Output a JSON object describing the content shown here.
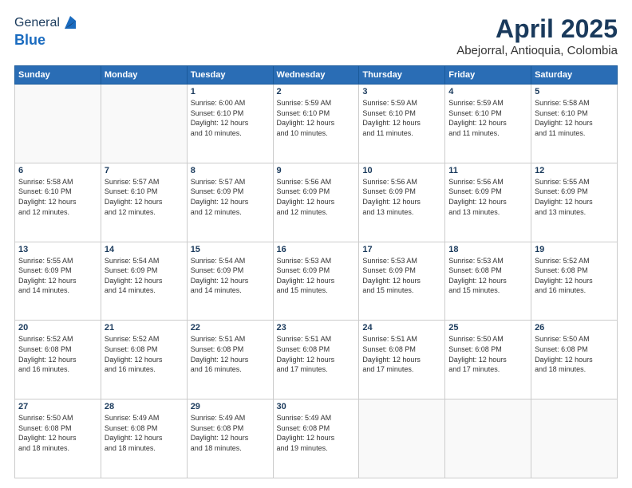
{
  "header": {
    "logo_general": "General",
    "logo_blue": "Blue",
    "title": "April 2025",
    "location": "Abejorral, Antioquia, Colombia"
  },
  "weekdays": [
    "Sunday",
    "Monday",
    "Tuesday",
    "Wednesday",
    "Thursday",
    "Friday",
    "Saturday"
  ],
  "weeks": [
    [
      {
        "day": "",
        "info": ""
      },
      {
        "day": "",
        "info": ""
      },
      {
        "day": "1",
        "info": "Sunrise: 6:00 AM\nSunset: 6:10 PM\nDaylight: 12 hours\nand 10 minutes."
      },
      {
        "day": "2",
        "info": "Sunrise: 5:59 AM\nSunset: 6:10 PM\nDaylight: 12 hours\nand 10 minutes."
      },
      {
        "day": "3",
        "info": "Sunrise: 5:59 AM\nSunset: 6:10 PM\nDaylight: 12 hours\nand 11 minutes."
      },
      {
        "day": "4",
        "info": "Sunrise: 5:59 AM\nSunset: 6:10 PM\nDaylight: 12 hours\nand 11 minutes."
      },
      {
        "day": "5",
        "info": "Sunrise: 5:58 AM\nSunset: 6:10 PM\nDaylight: 12 hours\nand 11 minutes."
      }
    ],
    [
      {
        "day": "6",
        "info": "Sunrise: 5:58 AM\nSunset: 6:10 PM\nDaylight: 12 hours\nand 12 minutes."
      },
      {
        "day": "7",
        "info": "Sunrise: 5:57 AM\nSunset: 6:10 PM\nDaylight: 12 hours\nand 12 minutes."
      },
      {
        "day": "8",
        "info": "Sunrise: 5:57 AM\nSunset: 6:09 PM\nDaylight: 12 hours\nand 12 minutes."
      },
      {
        "day": "9",
        "info": "Sunrise: 5:56 AM\nSunset: 6:09 PM\nDaylight: 12 hours\nand 12 minutes."
      },
      {
        "day": "10",
        "info": "Sunrise: 5:56 AM\nSunset: 6:09 PM\nDaylight: 12 hours\nand 13 minutes."
      },
      {
        "day": "11",
        "info": "Sunrise: 5:56 AM\nSunset: 6:09 PM\nDaylight: 12 hours\nand 13 minutes."
      },
      {
        "day": "12",
        "info": "Sunrise: 5:55 AM\nSunset: 6:09 PM\nDaylight: 12 hours\nand 13 minutes."
      }
    ],
    [
      {
        "day": "13",
        "info": "Sunrise: 5:55 AM\nSunset: 6:09 PM\nDaylight: 12 hours\nand 14 minutes."
      },
      {
        "day": "14",
        "info": "Sunrise: 5:54 AM\nSunset: 6:09 PM\nDaylight: 12 hours\nand 14 minutes."
      },
      {
        "day": "15",
        "info": "Sunrise: 5:54 AM\nSunset: 6:09 PM\nDaylight: 12 hours\nand 14 minutes."
      },
      {
        "day": "16",
        "info": "Sunrise: 5:53 AM\nSunset: 6:09 PM\nDaylight: 12 hours\nand 15 minutes."
      },
      {
        "day": "17",
        "info": "Sunrise: 5:53 AM\nSunset: 6:09 PM\nDaylight: 12 hours\nand 15 minutes."
      },
      {
        "day": "18",
        "info": "Sunrise: 5:53 AM\nSunset: 6:08 PM\nDaylight: 12 hours\nand 15 minutes."
      },
      {
        "day": "19",
        "info": "Sunrise: 5:52 AM\nSunset: 6:08 PM\nDaylight: 12 hours\nand 16 minutes."
      }
    ],
    [
      {
        "day": "20",
        "info": "Sunrise: 5:52 AM\nSunset: 6:08 PM\nDaylight: 12 hours\nand 16 minutes."
      },
      {
        "day": "21",
        "info": "Sunrise: 5:52 AM\nSunset: 6:08 PM\nDaylight: 12 hours\nand 16 minutes."
      },
      {
        "day": "22",
        "info": "Sunrise: 5:51 AM\nSunset: 6:08 PM\nDaylight: 12 hours\nand 16 minutes."
      },
      {
        "day": "23",
        "info": "Sunrise: 5:51 AM\nSunset: 6:08 PM\nDaylight: 12 hours\nand 17 minutes."
      },
      {
        "day": "24",
        "info": "Sunrise: 5:51 AM\nSunset: 6:08 PM\nDaylight: 12 hours\nand 17 minutes."
      },
      {
        "day": "25",
        "info": "Sunrise: 5:50 AM\nSunset: 6:08 PM\nDaylight: 12 hours\nand 17 minutes."
      },
      {
        "day": "26",
        "info": "Sunrise: 5:50 AM\nSunset: 6:08 PM\nDaylight: 12 hours\nand 18 minutes."
      }
    ],
    [
      {
        "day": "27",
        "info": "Sunrise: 5:50 AM\nSunset: 6:08 PM\nDaylight: 12 hours\nand 18 minutes."
      },
      {
        "day": "28",
        "info": "Sunrise: 5:49 AM\nSunset: 6:08 PM\nDaylight: 12 hours\nand 18 minutes."
      },
      {
        "day": "29",
        "info": "Sunrise: 5:49 AM\nSunset: 6:08 PM\nDaylight: 12 hours\nand 18 minutes."
      },
      {
        "day": "30",
        "info": "Sunrise: 5:49 AM\nSunset: 6:08 PM\nDaylight: 12 hours\nand 19 minutes."
      },
      {
        "day": "",
        "info": ""
      },
      {
        "day": "",
        "info": ""
      },
      {
        "day": "",
        "info": ""
      }
    ]
  ]
}
